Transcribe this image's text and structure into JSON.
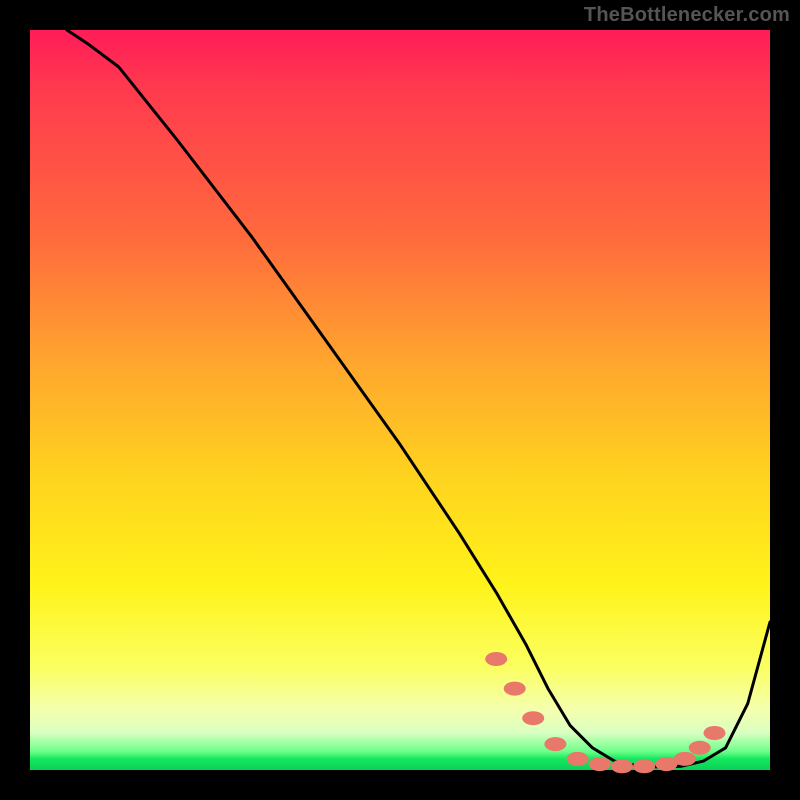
{
  "attribution": "TheBottlenecker.com",
  "chart_data": {
    "type": "line",
    "title": "",
    "xlabel": "",
    "ylabel": "",
    "xlim": [
      0,
      100
    ],
    "ylim": [
      0,
      100
    ],
    "series": [
      {
        "name": "curve",
        "x": [
          5,
          8,
          12,
          20,
          30,
          40,
          50,
          58,
          63,
          67,
          70,
          73,
          76,
          79,
          82,
          85,
          88,
          91,
          94,
          97,
          100
        ],
        "y": [
          100,
          98,
          95,
          85,
          72,
          58,
          44,
          32,
          24,
          17,
          11,
          6,
          3,
          1.2,
          0.6,
          0.4,
          0.5,
          1.2,
          3,
          9,
          20
        ]
      }
    ],
    "markers": [
      {
        "x": 63,
        "y": 15
      },
      {
        "x": 65.5,
        "y": 11
      },
      {
        "x": 68,
        "y": 7
      },
      {
        "x": 71,
        "y": 3.5
      },
      {
        "x": 74,
        "y": 1.5
      },
      {
        "x": 77,
        "y": 0.8
      },
      {
        "x": 80,
        "y": 0.5
      },
      {
        "x": 83,
        "y": 0.5
      },
      {
        "x": 86,
        "y": 0.8
      },
      {
        "x": 88.5,
        "y": 1.5
      },
      {
        "x": 90.5,
        "y": 3
      },
      {
        "x": 92.5,
        "y": 5
      }
    ],
    "marker_color": "#e8786a",
    "curve_color": "#000000"
  }
}
